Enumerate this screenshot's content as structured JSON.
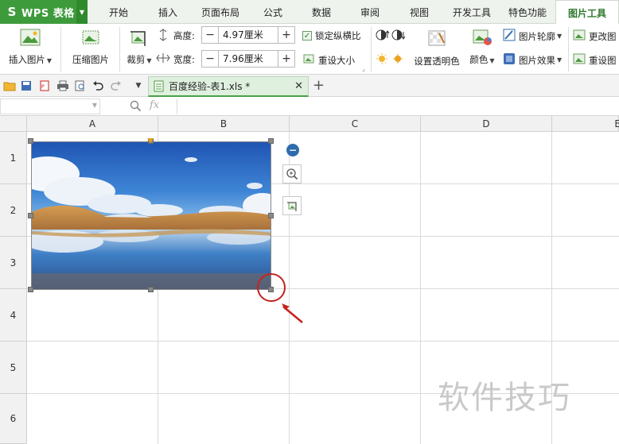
{
  "app": {
    "logo_text": "WPS 表格"
  },
  "menu": {
    "tabs": [
      {
        "label": "开始"
      },
      {
        "label": "插入"
      },
      {
        "label": "页面布局"
      },
      {
        "label": "公式"
      },
      {
        "label": "数据"
      },
      {
        "label": "审阅"
      },
      {
        "label": "视图"
      },
      {
        "label": "开发工具"
      },
      {
        "label": "特色功能"
      },
      {
        "label": "图片工具",
        "active": true
      }
    ]
  },
  "ribbon": {
    "insert_picture": "插入图片",
    "compress_picture": "压缩图片",
    "crop": "裁剪",
    "height_label": "高度:",
    "height_value": "4.97厘米",
    "width_label": "宽度:",
    "width_value": "7.96厘米",
    "lock_ratio": "锁定纵横比",
    "reset_size": "重设大小",
    "set_transparent": "设置透明色",
    "color": "颜色",
    "picture_outline": "图片轮廓",
    "picture_effect": "图片效果",
    "change_picture": "更改图",
    "reset_picture": "重设图"
  },
  "document_tab": {
    "name": "百度经验-表1.xls *"
  },
  "formula_bar": {
    "fx": "fx"
  },
  "sheet": {
    "columns": [
      "A",
      "B",
      "C",
      "D",
      "E"
    ],
    "rows": [
      "1",
      "2",
      "3",
      "4",
      "5",
      "6"
    ]
  },
  "watermark": "软件技巧",
  "colors": {
    "accent": "#3e9b3c",
    "highlight": "#c8211c"
  }
}
